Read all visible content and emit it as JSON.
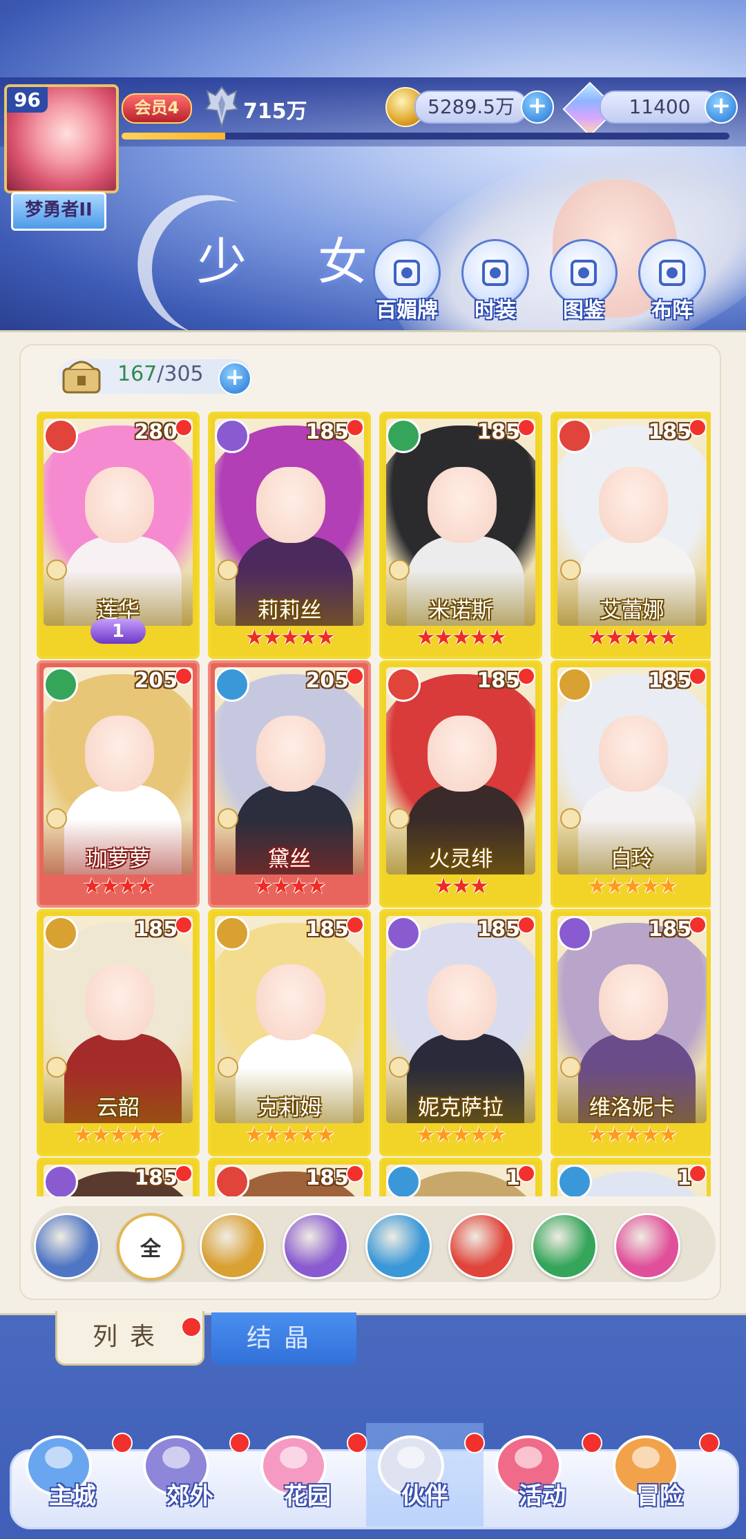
{
  "player": {
    "level": "96",
    "title": "梦勇者II",
    "vip": "会员4",
    "power": "715万",
    "xp_fraction": 0.17
  },
  "currency": {
    "gold": "5289.5万",
    "gems": "11400"
  },
  "page_title": "少 女",
  "quick_actions": [
    {
      "label": "百媚牌",
      "icon": "card-icon"
    },
    {
      "label": "时装",
      "icon": "outfit-icon"
    },
    {
      "label": "图鉴",
      "icon": "book-icon"
    },
    {
      "label": "布阵",
      "icon": "formation-icon"
    }
  ],
  "roster": {
    "owned": "167",
    "total": "/305"
  },
  "characters": [
    {
      "name": "莲华",
      "level": "280",
      "element": "fire",
      "stars": 0,
      "star_color": "red",
      "frame": "gold",
      "badge": "1",
      "hair": "#f58ad0",
      "body": "#f7f1f4"
    },
    {
      "name": "莉莉丝",
      "level": "185",
      "element": "moon",
      "stars": 5,
      "star_color": "red",
      "frame": "gold",
      "hair": "#b23fb5",
      "body": "#4d2a5e"
    },
    {
      "name": "米诺斯",
      "level": "185",
      "element": "wind",
      "stars": 5,
      "star_color": "red",
      "frame": "gold",
      "hair": "#2b2b2e",
      "body": "#ececec"
    },
    {
      "name": "艾蕾娜",
      "level": "185",
      "element": "fire",
      "stars": 5,
      "star_color": "red",
      "frame": "gold",
      "hair": "#eceff4",
      "body": "#f5f2f2"
    },
    {
      "name": "珈萝萝",
      "level": "205",
      "element": "wind",
      "stars": 4,
      "star_color": "red",
      "frame": "red",
      "hair": "#e8c677",
      "body": "#ffffff"
    },
    {
      "name": "黛丝",
      "level": "205",
      "element": "water",
      "stars": 4,
      "star_color": "red",
      "frame": "red",
      "hair": "#c6c8e0",
      "body": "#2a2e3d"
    },
    {
      "name": "火灵绯",
      "level": "185",
      "element": "fire",
      "stars": 3,
      "star_color": "red",
      "frame": "gold",
      "hair": "#d93a3a",
      "body": "#3b2a2a"
    },
    {
      "name": "白玲",
      "level": "185",
      "element": "sun",
      "stars": 5,
      "star_color": "gold",
      "frame": "gold",
      "hair": "#e9ecf2",
      "body": "#f4f1f3"
    },
    {
      "name": "云韶",
      "level": "185",
      "element": "sun",
      "stars": 5,
      "star_color": "gold",
      "frame": "gold",
      "hair": "#efe7d1",
      "body": "#a52a2a"
    },
    {
      "name": "克莉姆",
      "level": "185",
      "element": "sun",
      "stars": 5,
      "star_color": "gold",
      "frame": "gold",
      "hair": "#f3dc8d",
      "body": "#ffffff"
    },
    {
      "name": "妮克萨拉",
      "level": "185",
      "element": "moon",
      "stars": 5,
      "star_color": "gold",
      "frame": "gold",
      "hair": "#d9dcef",
      "body": "#2a2a3a"
    },
    {
      "name": "维洛妮卡",
      "level": "185",
      "element": "moon",
      "stars": 5,
      "star_color": "gold",
      "frame": "gold",
      "hair": "#b9a5c9",
      "body": "#6b4c8a"
    },
    {
      "name": "",
      "level": "185",
      "element": "moon",
      "stars": 0,
      "star_color": "gold",
      "frame": "gold",
      "hair": "#5a3a2e",
      "body": "#5a3a2e"
    },
    {
      "name": "",
      "level": "185",
      "element": "fire",
      "stars": 0,
      "star_color": "gold",
      "frame": "gold",
      "hair": "#a0623a",
      "body": "#a0623a"
    },
    {
      "name": "",
      "level": "1",
      "element": "water",
      "stars": 0,
      "star_color": "gold",
      "frame": "gold",
      "hair": "#c8a86a",
      "body": "#c8a86a"
    },
    {
      "name": "",
      "level": "1",
      "element": "water",
      "stars": 0,
      "star_color": "gold",
      "frame": "gold",
      "hair": "#dfe6f2",
      "body": "#dfe6f2"
    }
  ],
  "filters": [
    {
      "label": "",
      "name": "filter-rank",
      "color": "#4f76c4"
    },
    {
      "label": "全",
      "name": "filter-all",
      "color": "#ffffff"
    },
    {
      "label": "",
      "name": "filter-sun",
      "color": "#d9a032"
    },
    {
      "label": "",
      "name": "filter-moon",
      "color": "#8a5bd0"
    },
    {
      "label": "",
      "name": "filter-water",
      "color": "#3a98d8"
    },
    {
      "label": "",
      "name": "filter-fire",
      "color": "#e0443a"
    },
    {
      "label": "",
      "name": "filter-wind",
      "color": "#35a55a"
    },
    {
      "label": "",
      "name": "filter-star",
      "color": "#e0509a"
    }
  ],
  "tabs": {
    "list": "列表",
    "crystal": "结晶"
  },
  "nav": [
    {
      "label": "主城",
      "icon": "castle-icon"
    },
    {
      "label": "郊外",
      "icon": "gate-icon"
    },
    {
      "label": "花园",
      "icon": "heart-garden-icon"
    },
    {
      "label": "伙伴",
      "icon": "partner-icon"
    },
    {
      "label": "活动",
      "icon": "gift-icon"
    },
    {
      "label": "冒险",
      "icon": "compass-icon"
    }
  ],
  "colors": {
    "fire": "#e0443a",
    "moon": "#8a5bd0",
    "wind": "#35a55a",
    "water": "#3a98d8",
    "sun": "#d9a032"
  }
}
